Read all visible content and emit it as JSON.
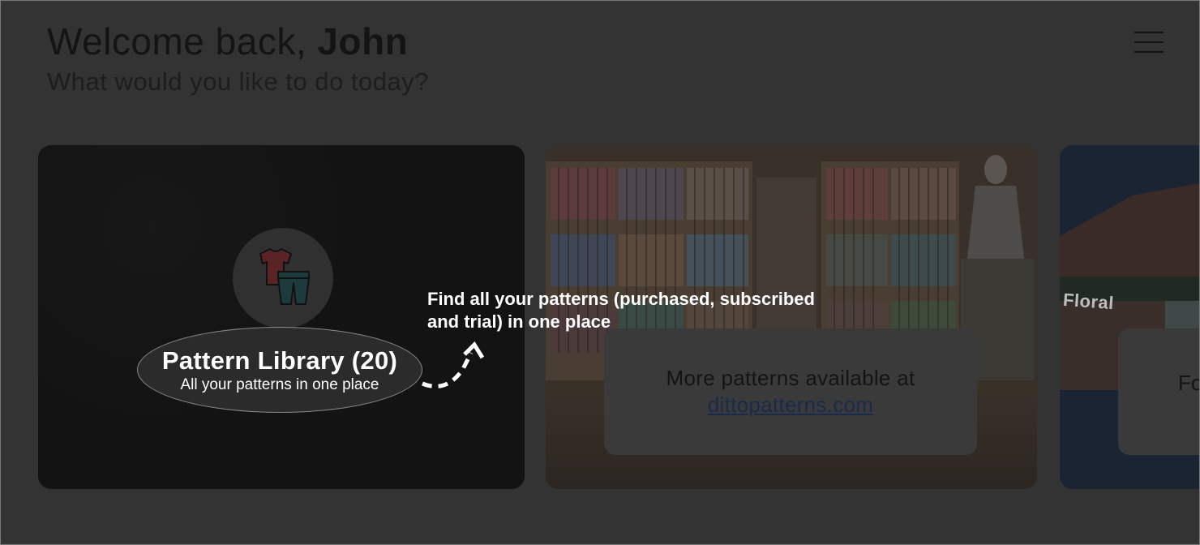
{
  "header": {
    "greeting_prefix": "Welcome back, ",
    "user_name": "John",
    "subtitle": "What would you like to do today?"
  },
  "cards": {
    "library": {
      "title": "Pattern Library (20)",
      "subtitle": "All your patterns in one place"
    },
    "store": {
      "text": "More patterns available at",
      "link": "dittopatterns.com"
    },
    "third": {
      "sign": "Floral",
      "panel_text": "Fo"
    }
  },
  "tooltip": {
    "text": "Find all your patterns (purchased, subscribed and trial) in one place"
  },
  "icons": {
    "menu": "hamburger-menu-icon",
    "library": "clothing-icon",
    "arrow": "dashed-arrow-icon"
  },
  "colors": {
    "overlay_background": "#333333",
    "tooltip_text": "#ffffff",
    "link": "#1a2a4a"
  }
}
